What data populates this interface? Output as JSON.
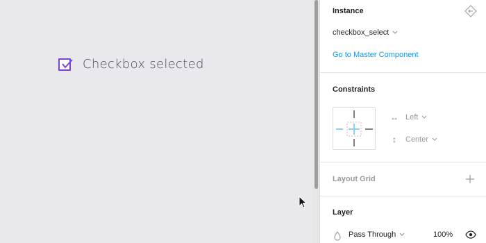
{
  "canvas": {
    "checkbox": {
      "label": "Checkbox selected",
      "checked": true,
      "accent": "#7b45d9"
    }
  },
  "panel": {
    "instance": {
      "title": "Instance",
      "component_name": "checkbox_select",
      "master_link": "Go to Master Component",
      "icons": [
        "reset-instance-icon",
        "chevron-down-icon"
      ]
    },
    "constraints": {
      "title": "Constraints",
      "horizontal": "Left",
      "vertical": "Center",
      "icons": [
        "horizontal-constraint-icon",
        "vertical-constraint-icon"
      ]
    },
    "layout_grid": {
      "title": "Layout Grid",
      "icons": [
        "plus-icon"
      ]
    },
    "layer": {
      "title": "Layer",
      "blend_mode": "Pass Through",
      "opacity": "100%",
      "icons": [
        "blend-mode-icon",
        "eye-icon"
      ]
    }
  },
  "colors": {
    "link": "#1896d8",
    "constraint_active": "#8fd0ee",
    "canvas_bg": "#e8e8ed"
  }
}
